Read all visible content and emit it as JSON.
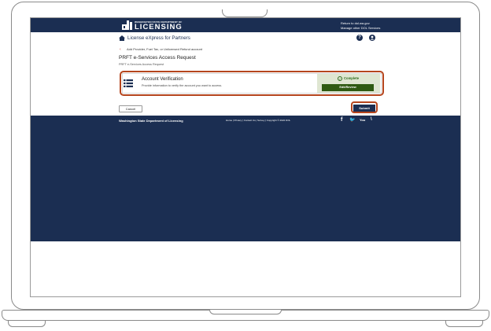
{
  "header": {
    "logo_small": "WASHINGTON STATE DEPARTMENT OF",
    "logo_big": "LICENSING",
    "link_return": "Return to dol.wa.gov",
    "link_manage": "Manage other DOL Services"
  },
  "nav": {
    "title": "License eXpress for Partners",
    "help_glyph": "?"
  },
  "breadcrumb": {
    "arrow": "‹",
    "text": "Add Provider, Fuel Tax, or Unlicensed Refund account"
  },
  "page": {
    "title": "PRFT e-Services Access Request",
    "subtitle": "PRFT e-Services Access Request"
  },
  "card": {
    "title": "Account Verification",
    "description": "Provide information to verify the account you want to access.",
    "status_glyph": "✓",
    "status": "Complete",
    "edit_label": "Edit/Review"
  },
  "actions": {
    "cancel_label": "Cancel",
    "submit_label": "Submit"
  },
  "footer": {
    "title": "Washington State Department of Licensing",
    "links": "Home | Privacy | Contact Us | Survey | Copyright © 2022 DOL",
    "social": {
      "facebook": "f",
      "twitter": "🐦",
      "youtube": "You",
      "rss": "\\"
    }
  },
  "colors": {
    "navy": "#1b2e52",
    "highlight": "#b5451d",
    "green": "#2f5a12"
  }
}
